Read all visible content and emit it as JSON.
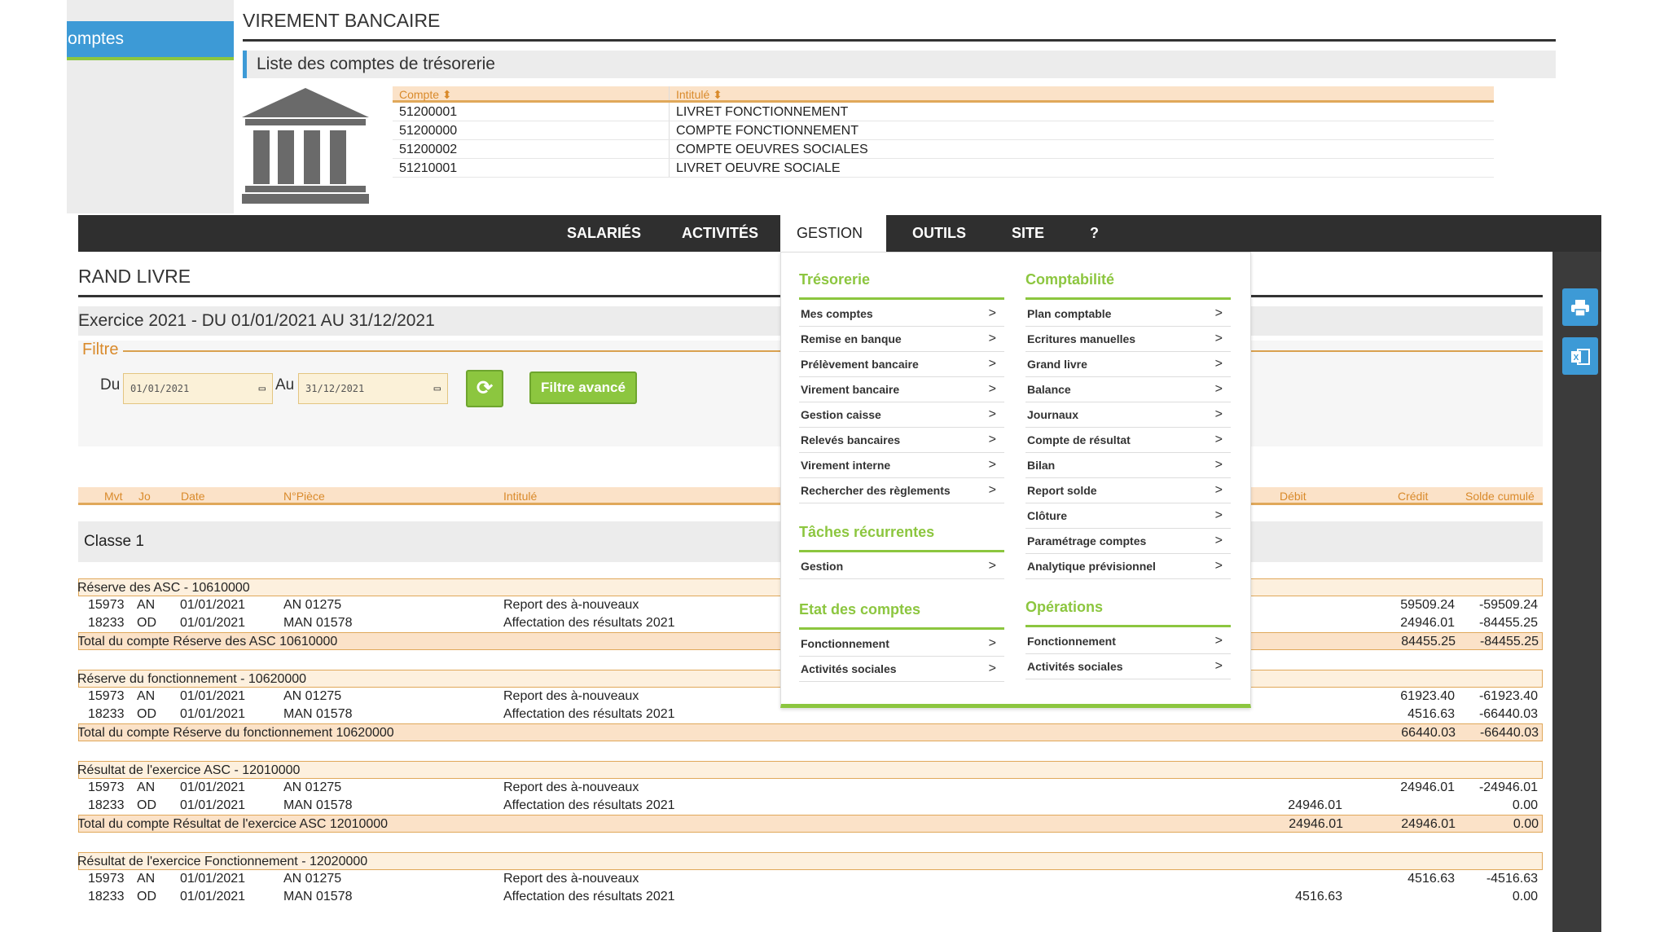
{
  "top": {
    "sidebar_item": "Comptes",
    "title": "VIREMENT BANCAIRE",
    "subtitle": "Liste des comptes de trésorerie",
    "table_headers": [
      "Compte ⬍",
      "Intitulé ⬍"
    ],
    "accounts": [
      {
        "compte": "51200001",
        "intitule": "LIVRET FONCTIONNEMENT"
      },
      {
        "compte": "51200000",
        "intitule": "COMPTE FONCTIONNEMENT"
      },
      {
        "compte": "51200002",
        "intitule": "COMPTE OEUVRES SOCIALES"
      },
      {
        "compte": "51210001",
        "intitule": "LIVRET OEUVRE SOCIALE"
      }
    ]
  },
  "nav": {
    "items": [
      "SALARIÉS",
      "ACTIVITÉS",
      "GESTION",
      "OUTILS",
      "SITE",
      "?"
    ],
    "active": "GESTION"
  },
  "page": {
    "title": "RAND LIVRE",
    "exercise": "Exercice 2021 - DU 01/01/2021 AU 31/12/2021",
    "filter_label": "Filtre",
    "du_label": "Du",
    "du_value": "01/01/2021",
    "au_label": "Au",
    "au_value": "31/12/2021",
    "advanced_filter": "Filtre avancé"
  },
  "ledger": {
    "headers": {
      "mvt": "Mvt",
      "jo": "Jo",
      "date": "Date",
      "piece": "N°Pièce",
      "intitule": "Intitulé",
      "debit": "Débit",
      "credit": "Crédit",
      "solde": "Solde cumulé"
    },
    "classe": "Classe 1",
    "accounts": [
      {
        "title": "Réserve des ASC - 10610000",
        "rows": [
          {
            "mvt": "15973",
            "jo": "AN",
            "date": "01/01/2021",
            "piece": "AN 01275",
            "intitule": "Report des à-nouveaux",
            "debit": "",
            "credit": "59509.24",
            "solde": "-59509.24"
          },
          {
            "mvt": "18233",
            "jo": "OD",
            "date": "01/01/2021",
            "piece": "MAN 01578",
            "intitule": "Affectation des résultats 2021",
            "debit": "",
            "credit": "24946.01",
            "solde": "-84455.25"
          }
        ],
        "total_label": "Total du compte Réserve des ASC 10610000",
        "total_debit": "",
        "total_credit": "84455.25",
        "total_solde": "-84455.25"
      },
      {
        "title": "Réserve du fonctionnement - 10620000",
        "rows": [
          {
            "mvt": "15973",
            "jo": "AN",
            "date": "01/01/2021",
            "piece": "AN 01275",
            "intitule": "Report des à-nouveaux",
            "debit": "",
            "credit": "61923.40",
            "solde": "-61923.40"
          },
          {
            "mvt": "18233",
            "jo": "OD",
            "date": "01/01/2021",
            "piece": "MAN 01578",
            "intitule": "Affectation des résultats 2021",
            "debit": "",
            "credit": "4516.63",
            "solde": "-66440.03"
          }
        ],
        "total_label": "Total du compte Réserve du fonctionnement 10620000",
        "total_debit": "",
        "total_credit": "66440.03",
        "total_solde": "-66440.03"
      },
      {
        "title": "Résultat de l'exercice ASC - 12010000",
        "rows": [
          {
            "mvt": "15973",
            "jo": "AN",
            "date": "01/01/2021",
            "piece": "AN 01275",
            "intitule": "Report des à-nouveaux",
            "debit": "",
            "credit": "24946.01",
            "solde": "-24946.01"
          },
          {
            "mvt": "18233",
            "jo": "OD",
            "date": "01/01/2021",
            "piece": "MAN 01578",
            "intitule": "Affectation des résultats 2021",
            "debit": "24946.01",
            "credit": "",
            "solde": "0.00"
          }
        ],
        "total_label": "Total du compte Résultat de l'exercice ASC 12010000",
        "total_debit": "24946.01",
        "total_credit": "24946.01",
        "total_solde": "0.00"
      },
      {
        "title": "Résultat de l'exercice Fonctionnement - 12020000",
        "rows": [
          {
            "mvt": "15973",
            "jo": "AN",
            "date": "01/01/2021",
            "piece": "AN 01275",
            "intitule": "Report des à-nouveaux",
            "debit": "",
            "credit": "4516.63",
            "solde": "-4516.63"
          },
          {
            "mvt": "18233",
            "jo": "OD",
            "date": "01/01/2021",
            "piece": "MAN 01578",
            "intitule": "Affectation des résultats 2021",
            "debit": "4516.63",
            "credit": "",
            "solde": "0.00"
          }
        ]
      }
    ]
  },
  "menu": {
    "tresorerie": {
      "title": "Trésorerie",
      "items": [
        "Mes comptes",
        "Remise en banque",
        "Prélèvement bancaire",
        "Virement bancaire",
        "Gestion caisse",
        "Relevés bancaires",
        "Virement interne",
        "Rechercher des règlements"
      ]
    },
    "taches": {
      "title": "Tâches récurrentes",
      "items": [
        "Gestion"
      ]
    },
    "etat": {
      "title": "Etat des comptes",
      "items": [
        "Fonctionnement",
        "Activités sociales"
      ]
    },
    "comptabilite": {
      "title": "Comptabilité",
      "items": [
        "Plan comptable",
        "Ecritures manuelles",
        "Grand livre",
        "Balance",
        "Journaux",
        "Compte de résultat",
        "Bilan",
        "Report solde",
        "Clôture",
        "Paramétrage comptes",
        "Analytique prévisionnel"
      ]
    },
    "operations": {
      "title": "Opérations",
      "items": [
        "Fonctionnement",
        "Activités sociales"
      ]
    },
    "arrow": ">"
  },
  "icons": {
    "print": "printer-icon",
    "excel": "excel-icon",
    "refresh": "refresh-icon",
    "bank": "bank-icon",
    "calendar": "calendar-icon"
  },
  "colors": {
    "accent_blue": "#3d9ad6",
    "accent_green": "#8cc63f",
    "header_orange": "#d98a2b",
    "navbar": "#2f2f2f"
  }
}
